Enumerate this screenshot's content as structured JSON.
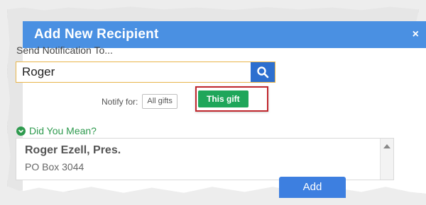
{
  "dialog": {
    "title": "Add New Recipient",
    "close_label": "×"
  },
  "notify": {
    "label": "Send Notification To...",
    "search_value": "Roger",
    "search_icon": "search-icon"
  },
  "notify_for": {
    "label": "Notify for:",
    "options": [
      "All gifts",
      "This gift"
    ],
    "selected": "This gift"
  },
  "suggestions": {
    "heading": "Did You Mean?",
    "items": [
      {
        "name": "Roger Ezell, Pres.",
        "address": "PO Box 3044"
      }
    ]
  },
  "actions": {
    "add_label": "Add"
  },
  "colors": {
    "header": "#4a90e2",
    "search_button": "#2d6fcf",
    "selected_toggle": "#1fa65a",
    "highlight": "#c0272d",
    "did_you_mean": "#2e9a4e"
  }
}
